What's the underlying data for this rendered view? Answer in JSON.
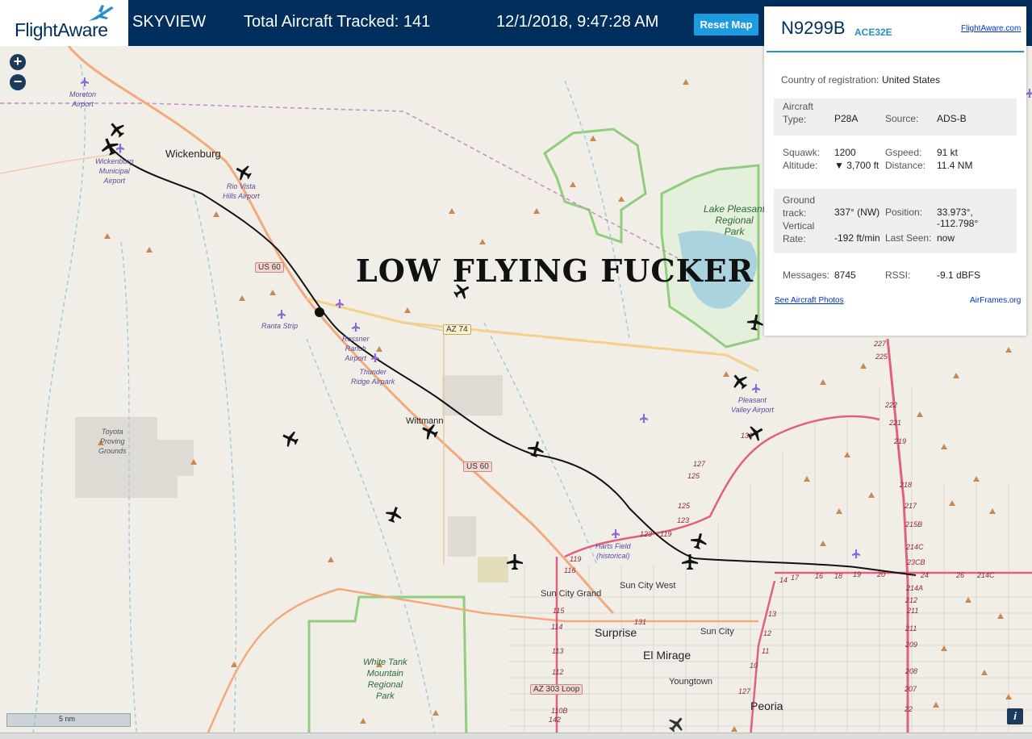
{
  "header": {
    "logo_text": "FlightAware",
    "app_name": "SKYVIEW",
    "total_aircraft": "Total Aircraft Tracked: 141",
    "datetime": "12/1/2018, 9:47:28 AM",
    "reset_label": "Reset Map"
  },
  "map": {
    "zoom_in": "+",
    "zoom_out": "−",
    "overlay_text": "LOW FLYING FUCKER",
    "scale_label": "5 nm",
    "info_label": "i",
    "places": {
      "moreton": "Moreton\nAirport",
      "wickenburg": "Wickenburg",
      "wickenburg_airport": "Wickenburg\nMunicipal\nAirport",
      "rio_vista": "Rio Vista\nHills Airport",
      "ranta": "Ranta Strip",
      "rossner": "Rossner\nRanch\nAirport",
      "thunder": "Thunder\nRidge Airpark",
      "wittmann": "Wittmann",
      "toyota": "Toyota\nProving\nGrounds",
      "lake_pleasant": "Lake Pleasant\nRegional\nPark",
      "pleasant_valley": "Pleasant\nValley Airport",
      "harts_field": "Harts Field\n(historical)",
      "sun_city_west": "Sun City West",
      "sun_city_grand": "Sun City Grand",
      "surprise": "Surprise",
      "sun_city": "Sun City",
      "el_mirage": "El Mirage",
      "youngtown": "Youngtown",
      "peoria": "Peoria",
      "white_tank": "White Tank\nMountain\nRegional\nPark",
      "us60_a": "US 60",
      "us60_b": "US 60",
      "az74": "AZ 74",
      "az303": "AZ 303 Loop"
    },
    "route_numbers": [
      "227",
      "225",
      "222",
      "221",
      "219",
      "218",
      "217",
      "215B",
      "214C",
      "23CB",
      "24",
      "26",
      "214C",
      "214A",
      "212",
      "211",
      "211",
      "209",
      "208",
      "207",
      "22",
      "20",
      "19",
      "18",
      "16",
      "17",
      "14",
      "13",
      "12",
      "11",
      "10",
      "127",
      "127",
      "125",
      "125",
      "123",
      "123",
      "119",
      "119",
      "116",
      "115",
      "114",
      "113",
      "112",
      "110B",
      "142",
      "131",
      "131"
    ]
  },
  "panel": {
    "registration": "N9299B",
    "hex": "ACE32E",
    "fa_link": "FlightAware.com",
    "country_label": "Country of registration:",
    "country_value": "United States",
    "aircraft_type_label": "Aircraft\nType:",
    "aircraft_type_value": "P28A",
    "source_label": "Source:",
    "source_value": "ADS-B",
    "squawk_label": "Squawk:",
    "squawk_value": "1200",
    "gspeed_label": "Gspeed:",
    "gspeed_value": "91 kt",
    "altitude_label": "Altitude:",
    "altitude_value": "▼ 3,700 ft",
    "distance_label": "Distance:",
    "distance_value": "11.4 NM",
    "track_label": "Ground\ntrack:",
    "track_value": "337° (NW)",
    "position_label": "Position:",
    "position_value": "33.973°, -112.798°",
    "vrate_label": "Vertical\nRate:",
    "vrate_value": "-192 ft/min",
    "lastseen_label": "Last Seen:",
    "lastseen_value": "now",
    "messages_label": "Messages:",
    "messages_value": "8745",
    "rssi_label": "RSSI:",
    "rssi_value": "-9.1 dBFS",
    "photos_link": "See Aircraft Photos",
    "airframes_link": "AirFrames.org"
  },
  "colors": {
    "header_bg": "#002f5d",
    "accent": "#1e9adf",
    "track_line": "#111111",
    "interstate": "#e06080",
    "highway": "#f4a97c",
    "park_border": "#8fce7d"
  }
}
